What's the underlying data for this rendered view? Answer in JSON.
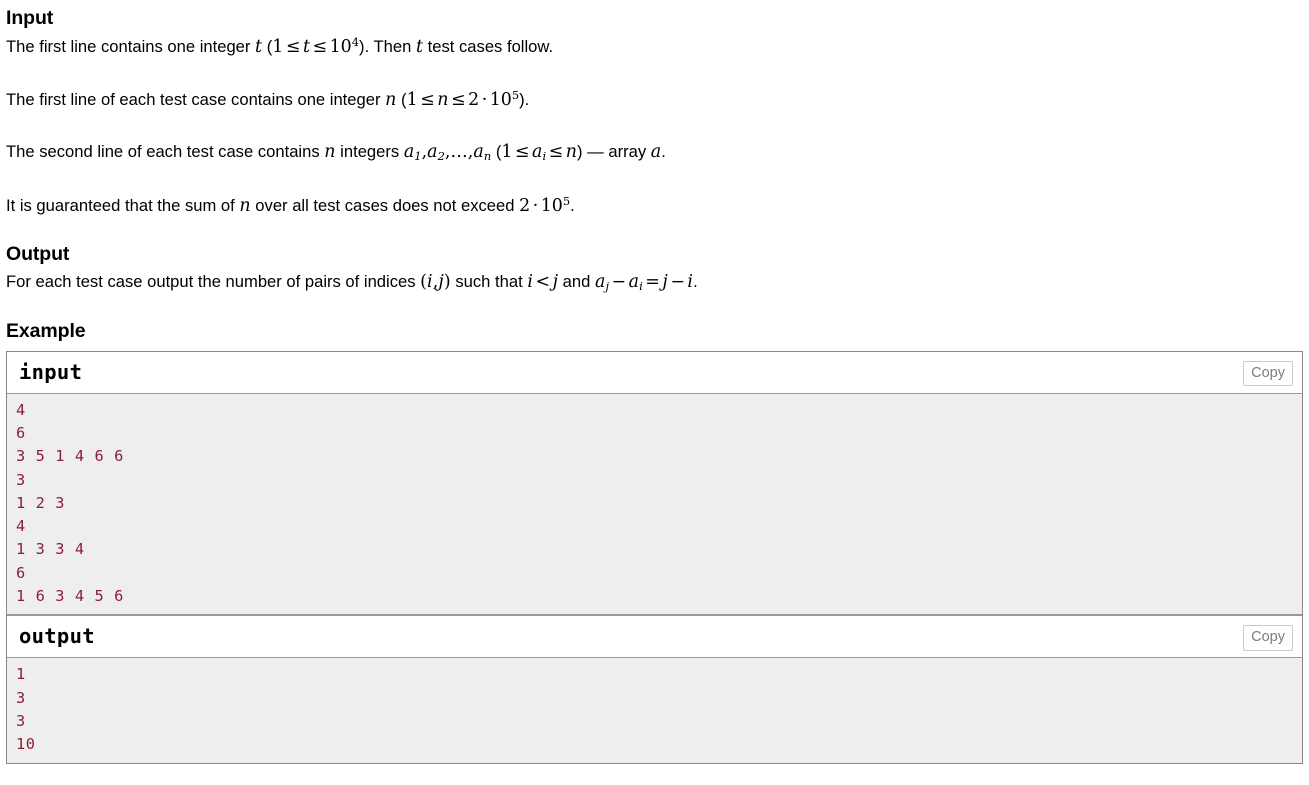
{
  "sections": {
    "input": {
      "heading": "Input",
      "paragraphs": [
        {
          "id": "p1",
          "parts": [
            {
              "t": "text",
              "v": "The first line contains one integer "
            },
            {
              "t": "math",
              "v": "t"
            },
            {
              "t": "text",
              "v": " ("
            },
            {
              "t": "math",
              "v": "1 ≤ t ≤ 10^4"
            },
            {
              "t": "text",
              "v": "). Then "
            },
            {
              "t": "math",
              "v": "t"
            },
            {
              "t": "text",
              "v": " test cases follow."
            }
          ],
          "plain": "The first line contains one integer t (1 ≤ t ≤ 10^4). Then t test cases follow."
        },
        {
          "id": "p2",
          "plain": "The first line of each test case contains one integer n (1 ≤ n ≤ 2 · 10^5)."
        },
        {
          "id": "p3",
          "plain": "The second line of each test case contains n integers a_1, a_2, …, a_n (1 ≤ a_i ≤ n) — array a."
        },
        {
          "id": "p4",
          "plain": "It is guaranteed that the sum of n over all test cases does not exceed 2 · 10^5."
        }
      ],
      "text_fragments": {
        "f1a": "The first line contains one integer ",
        "f1b": " (",
        "f1c": "). Then ",
        "f1d": " test cases follow.",
        "f2a": "The first line of each test case contains one integer ",
        "f2b": " (",
        "f2c": ").",
        "f3a": "The second line of each test case contains ",
        "f3b": " integers ",
        "f3c": " (",
        "f3d": ") — array ",
        "f3e": ".",
        "f4a": "It is guaranteed that the sum of ",
        "f4b": " over all test cases does not exceed ",
        "f4c": "."
      }
    },
    "output": {
      "heading": "Output",
      "text_fragments": {
        "o1a": "For each test case output the number of pairs of indices ",
        "o1b": " such that ",
        "o1c": " and ",
        "o1d": "."
      },
      "plain": "For each test case output the number of pairs of indices (i, j) such that i < j and a_j - a_i = j - i."
    },
    "example": {
      "heading": "Example",
      "blocks": [
        {
          "title": "input",
          "copy_label": "Copy",
          "content": "4\n6\n3 5 1 4 6 6\n3\n1 2 3\n4\n1 3 3 4\n6\n1 6 3 4 5 6"
        },
        {
          "title": "output",
          "copy_label": "Copy",
          "content": "1\n3\n3\n10"
        }
      ]
    }
  },
  "math": {
    "t": "t",
    "n": "n",
    "a": "a",
    "i": "i",
    "j": "j",
    "one": "1",
    "two": "2",
    "le": "≤",
    "lt": "<",
    "minus": "−",
    "eq": "=",
    "cdot": "·",
    "ten": "10",
    "exp4": "4",
    "exp5": "5",
    "sub1": "1",
    "sub2": "2",
    "subn": "n",
    "subi": "i",
    "subj": "j",
    "ellipsis": ",…,",
    "comma": ",",
    "lparen": "(",
    "rparen": ")",
    "pairij": "(i,j)"
  },
  "colors": {
    "sample_text": "#8a1f36",
    "sample_bg": "#eeeeee",
    "border": "#888888",
    "copy_text": "#7d7d7d",
    "copy_border": "#c9c9c9",
    "body_text": "#000000"
  }
}
